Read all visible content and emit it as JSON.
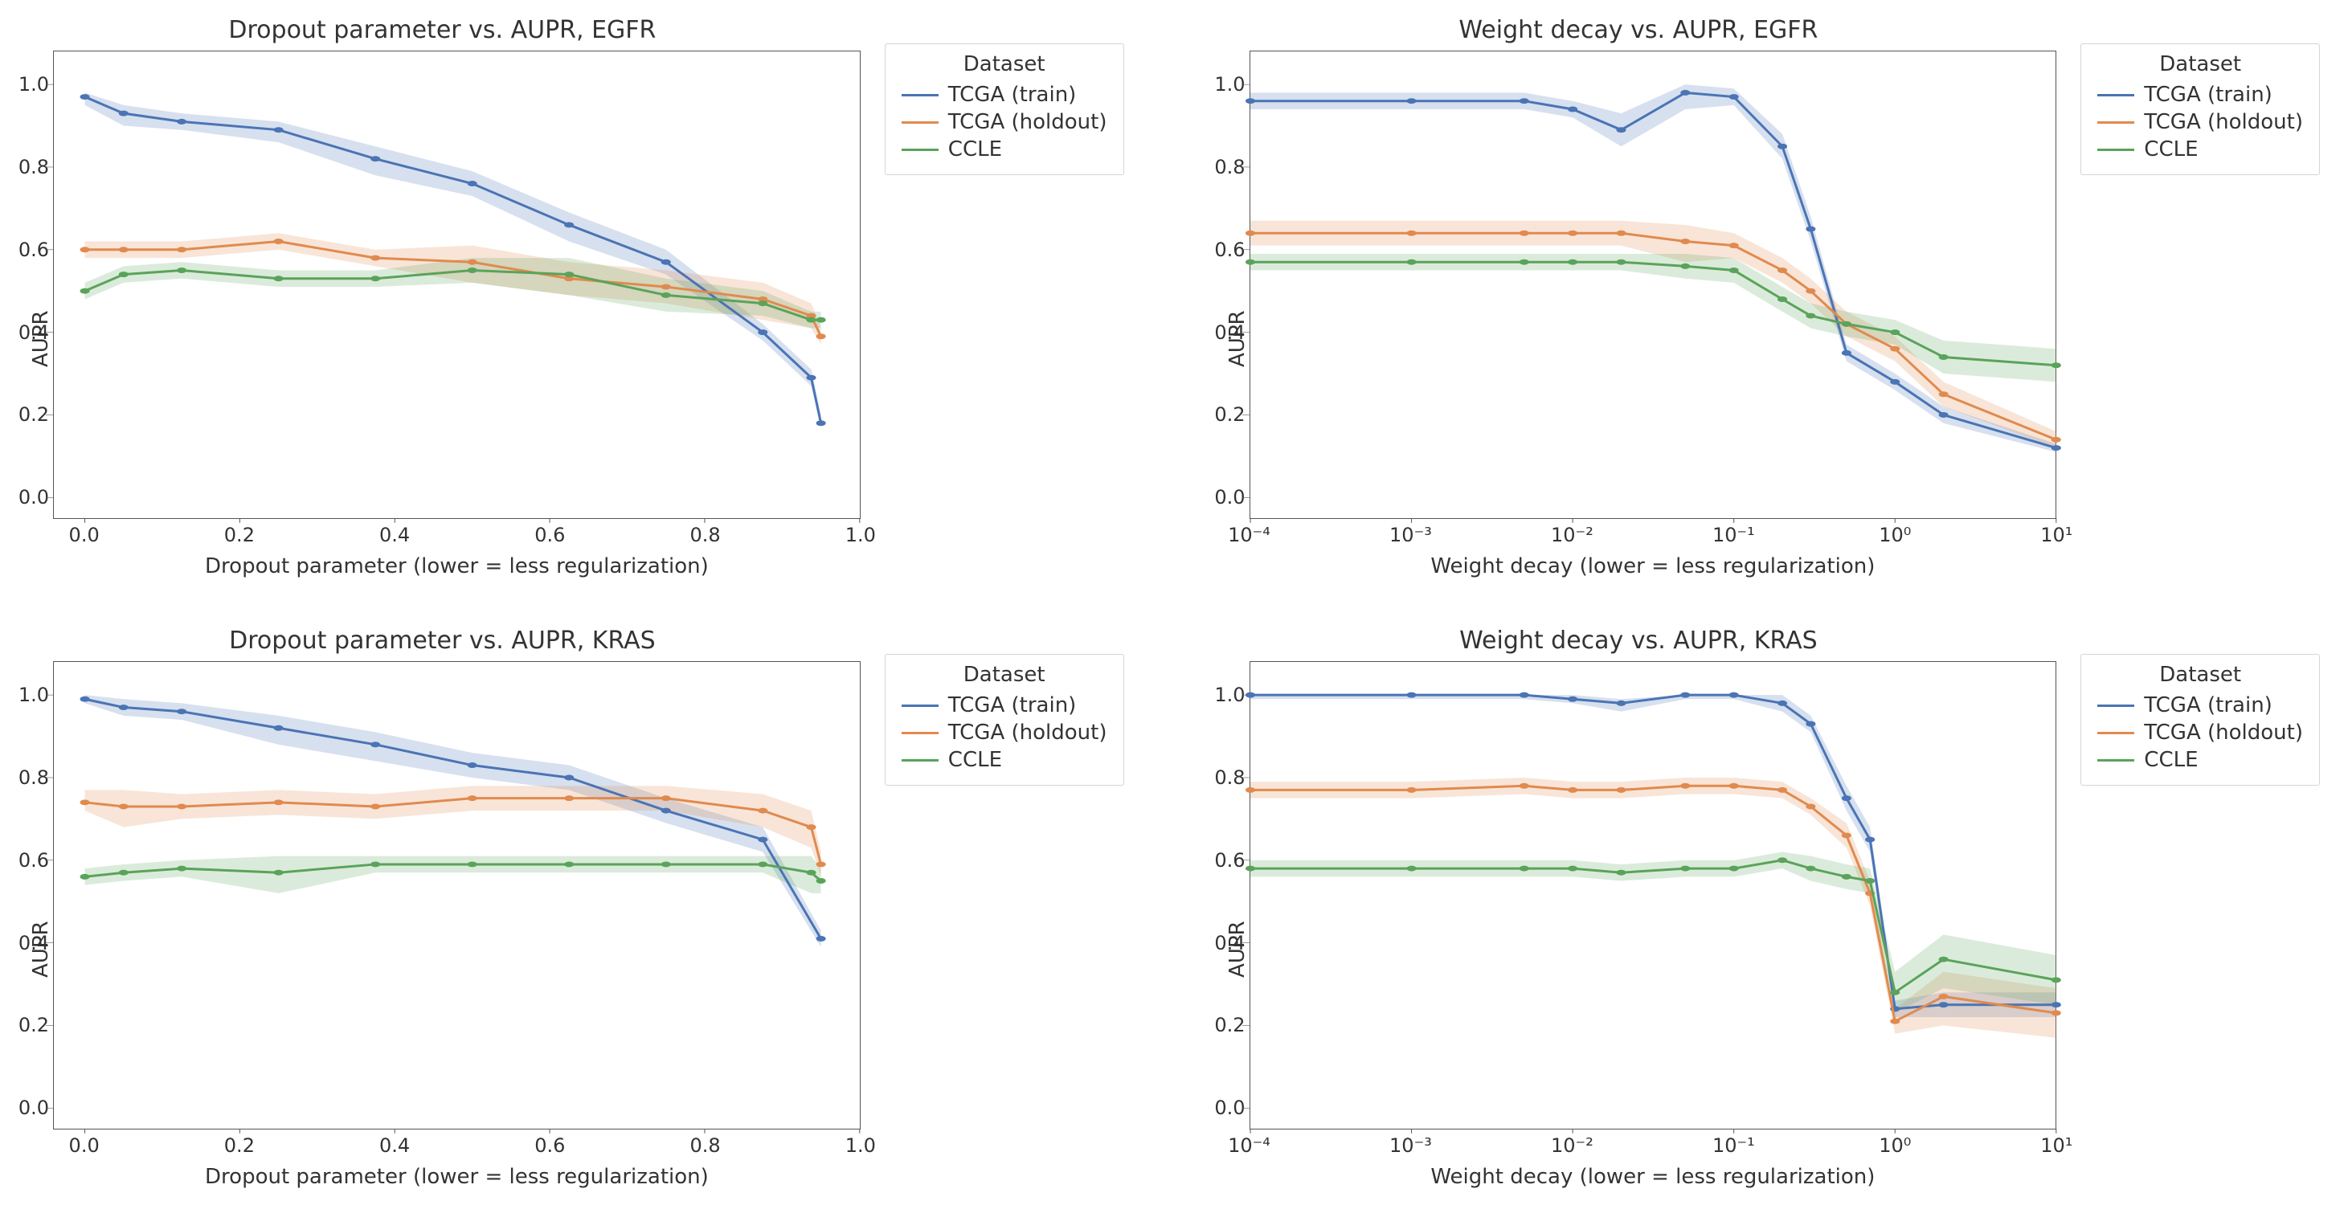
{
  "legend": {
    "title": "Dataset",
    "items": [
      {
        "name": "TCGA (train)",
        "color": "#4a74b4"
      },
      {
        "name": "TCGA (holdout)",
        "color": "#e18a4e"
      },
      {
        "name": "CCLE",
        "color": "#5aa35a"
      }
    ]
  },
  "panels": [
    {
      "id": "dropout-egfr",
      "title": "Dropout parameter vs. AUPR, EGFR",
      "xlabel": "Dropout parameter (lower = less regularization)",
      "ylabel": "AUPR",
      "xscale": "linear",
      "xlim": [
        -0.04,
        1.0
      ],
      "xticks": [
        0.0,
        0.2,
        0.4,
        0.6,
        0.8,
        1.0
      ],
      "ylim": [
        -0.05,
        1.08
      ],
      "yticks": [
        0.0,
        0.2,
        0.4,
        0.6,
        0.8,
        1.0
      ]
    },
    {
      "id": "wd-egfr",
      "title": "Weight decay vs. AUPR, EGFR",
      "xlabel": "Weight decay (lower = less regularization)",
      "ylabel": "AUPR",
      "xscale": "log",
      "xlim": [
        0.0001,
        10
      ],
      "xticks": [
        0.0001,
        0.001,
        0.01,
        0.1,
        1,
        10
      ],
      "xticklabels": [
        "10⁻⁴",
        "10⁻³",
        "10⁻²",
        "10⁻¹",
        "10⁰",
        "10¹"
      ],
      "ylim": [
        -0.05,
        1.08
      ],
      "yticks": [
        0.0,
        0.2,
        0.4,
        0.6,
        0.8,
        1.0
      ]
    },
    {
      "id": "dropout-kras",
      "title": "Dropout parameter vs. AUPR, KRAS",
      "xlabel": "Dropout parameter (lower = less regularization)",
      "ylabel": "AUPR",
      "xscale": "linear",
      "xlim": [
        -0.04,
        1.0
      ],
      "xticks": [
        0.0,
        0.2,
        0.4,
        0.6,
        0.8,
        1.0
      ],
      "ylim": [
        -0.05,
        1.08
      ],
      "yticks": [
        0.0,
        0.2,
        0.4,
        0.6,
        0.8,
        1.0
      ]
    },
    {
      "id": "wd-kras",
      "title": "Weight decay vs. AUPR, KRAS",
      "xlabel": "Weight decay (lower = less regularization)",
      "ylabel": "AUPR",
      "xscale": "log",
      "xlim": [
        0.0001,
        10
      ],
      "xticks": [
        0.0001,
        0.001,
        0.01,
        0.1,
        1,
        10
      ],
      "xticklabels": [
        "10⁻⁴",
        "10⁻³",
        "10⁻²",
        "10⁻¹",
        "10⁰",
        "10¹"
      ],
      "ylim": [
        -0.05,
        1.08
      ],
      "yticks": [
        0.0,
        0.2,
        0.4,
        0.6,
        0.8,
        1.0
      ]
    }
  ],
  "chart_data": [
    {
      "id": "dropout-egfr",
      "type": "line",
      "x": [
        0.0,
        0.05,
        0.125,
        0.25,
        0.375,
        0.5,
        0.625,
        0.75,
        0.875,
        0.95
      ],
      "series": [
        {
          "name": "TCGA (train)",
          "color": "#4a74b4",
          "y": [
            0.97,
            0.93,
            0.91,
            0.89,
            0.82,
            0.76,
            0.66,
            0.57,
            0.4,
            0.29,
            0.18
          ],
          "lo": [
            0.95,
            0.9,
            0.89,
            0.86,
            0.78,
            0.73,
            0.62,
            0.54,
            0.38,
            0.27,
            0.17
          ],
          "hi": [
            0.98,
            0.95,
            0.93,
            0.91,
            0.85,
            0.79,
            0.69,
            0.6,
            0.42,
            0.31,
            0.2
          ],
          "x": [
            0.0,
            0.05,
            0.125,
            0.25,
            0.375,
            0.5,
            0.625,
            0.75,
            0.875,
            0.9375,
            0.95
          ]
        },
        {
          "name": "TCGA (holdout)",
          "color": "#e18a4e",
          "y": [
            0.6,
            0.6,
            0.6,
            0.62,
            0.58,
            0.57,
            0.53,
            0.51,
            0.48,
            0.44,
            0.39
          ],
          "lo": [
            0.58,
            0.58,
            0.58,
            0.6,
            0.56,
            0.52,
            0.49,
            0.47,
            0.43,
            0.41,
            0.37
          ],
          "hi": [
            0.62,
            0.62,
            0.62,
            0.64,
            0.6,
            0.61,
            0.57,
            0.55,
            0.52,
            0.47,
            0.41
          ],
          "x": [
            0.0,
            0.05,
            0.125,
            0.25,
            0.375,
            0.5,
            0.625,
            0.75,
            0.875,
            0.9375,
            0.95
          ]
        },
        {
          "name": "CCLE",
          "color": "#5aa35a",
          "y": [
            0.5,
            0.54,
            0.55,
            0.53,
            0.53,
            0.55,
            0.54,
            0.49,
            0.47,
            0.43,
            0.43
          ],
          "lo": [
            0.48,
            0.52,
            0.53,
            0.51,
            0.51,
            0.52,
            0.49,
            0.45,
            0.44,
            0.41,
            0.41
          ],
          "hi": [
            0.52,
            0.56,
            0.57,
            0.55,
            0.55,
            0.58,
            0.58,
            0.53,
            0.5,
            0.45,
            0.45
          ],
          "x": [
            0.0,
            0.05,
            0.125,
            0.25,
            0.375,
            0.5,
            0.625,
            0.75,
            0.875,
            0.9375,
            0.95
          ]
        }
      ]
    },
    {
      "id": "wd-egfr",
      "type": "line",
      "x": [
        0.0001,
        0.001,
        0.005,
        0.01,
        0.02,
        0.05,
        0.1,
        0.2,
        0.3,
        0.5,
        1,
        2,
        10
      ],
      "series": [
        {
          "name": "TCGA (train)",
          "color": "#4a74b4",
          "y": [
            0.96,
            0.96,
            0.96,
            0.94,
            0.89,
            0.98,
            0.97,
            0.85,
            0.65,
            0.35,
            0.28,
            0.2,
            0.12
          ],
          "lo": [
            0.94,
            0.94,
            0.94,
            0.92,
            0.85,
            0.94,
            0.95,
            0.82,
            0.62,
            0.33,
            0.26,
            0.18,
            0.11
          ],
          "hi": [
            0.98,
            0.98,
            0.98,
            0.96,
            0.93,
            1.0,
            0.99,
            0.88,
            0.68,
            0.37,
            0.3,
            0.22,
            0.13
          ]
        },
        {
          "name": "TCGA (holdout)",
          "color": "#e18a4e",
          "y": [
            0.64,
            0.64,
            0.64,
            0.64,
            0.64,
            0.62,
            0.61,
            0.55,
            0.5,
            0.42,
            0.36,
            0.25,
            0.14
          ],
          "lo": [
            0.61,
            0.61,
            0.61,
            0.61,
            0.61,
            0.57,
            0.58,
            0.52,
            0.47,
            0.39,
            0.33,
            0.22,
            0.12
          ],
          "hi": [
            0.67,
            0.67,
            0.67,
            0.67,
            0.67,
            0.66,
            0.64,
            0.58,
            0.53,
            0.45,
            0.39,
            0.28,
            0.16
          ]
        },
        {
          "name": "CCLE",
          "color": "#5aa35a",
          "y": [
            0.57,
            0.57,
            0.57,
            0.57,
            0.57,
            0.56,
            0.55,
            0.48,
            0.44,
            0.42,
            0.4,
            0.34,
            0.32
          ],
          "lo": [
            0.55,
            0.55,
            0.55,
            0.55,
            0.55,
            0.53,
            0.52,
            0.45,
            0.41,
            0.39,
            0.37,
            0.3,
            0.28
          ],
          "hi": [
            0.59,
            0.59,
            0.59,
            0.59,
            0.59,
            0.59,
            0.58,
            0.51,
            0.47,
            0.45,
            0.43,
            0.38,
            0.36
          ]
        }
      ]
    },
    {
      "id": "dropout-kras",
      "type": "line",
      "x": [
        0.0,
        0.05,
        0.125,
        0.25,
        0.375,
        0.5,
        0.625,
        0.75,
        0.875,
        0.95
      ],
      "series": [
        {
          "name": "TCGA (train)",
          "color": "#4a74b4",
          "y": [
            0.99,
            0.97,
            0.96,
            0.92,
            0.88,
            0.83,
            0.8,
            0.72,
            0.65,
            0.41
          ],
          "lo": [
            0.98,
            0.95,
            0.94,
            0.88,
            0.84,
            0.8,
            0.77,
            0.69,
            0.62,
            0.39
          ],
          "hi": [
            1.0,
            0.99,
            0.98,
            0.95,
            0.91,
            0.86,
            0.83,
            0.75,
            0.68,
            0.43
          ]
        },
        {
          "name": "TCGA (holdout)",
          "color": "#e18a4e",
          "y": [
            0.74,
            0.73,
            0.73,
            0.74,
            0.73,
            0.75,
            0.75,
            0.75,
            0.72,
            0.68,
            0.59
          ],
          "lo": [
            0.72,
            0.68,
            0.7,
            0.71,
            0.7,
            0.72,
            0.72,
            0.72,
            0.68,
            0.63,
            0.56
          ],
          "hi": [
            0.77,
            0.77,
            0.76,
            0.77,
            0.76,
            0.78,
            0.78,
            0.78,
            0.76,
            0.72,
            0.62
          ],
          "x": [
            0.0,
            0.05,
            0.125,
            0.25,
            0.375,
            0.5,
            0.625,
            0.75,
            0.875,
            0.9375,
            0.95
          ]
        },
        {
          "name": "CCLE",
          "color": "#5aa35a",
          "y": [
            0.56,
            0.57,
            0.58,
            0.57,
            0.59,
            0.59,
            0.59,
            0.59,
            0.59,
            0.57,
            0.55
          ],
          "lo": [
            0.54,
            0.55,
            0.56,
            0.52,
            0.57,
            0.57,
            0.57,
            0.57,
            0.57,
            0.52,
            0.52
          ],
          "hi": [
            0.58,
            0.59,
            0.6,
            0.61,
            0.61,
            0.61,
            0.61,
            0.61,
            0.61,
            0.61,
            0.58
          ],
          "x": [
            0.0,
            0.05,
            0.125,
            0.25,
            0.375,
            0.5,
            0.625,
            0.75,
            0.875,
            0.9375,
            0.95
          ]
        }
      ]
    },
    {
      "id": "wd-kras",
      "type": "line",
      "x": [
        0.0001,
        0.001,
        0.005,
        0.01,
        0.02,
        0.05,
        0.1,
        0.2,
        0.3,
        0.5,
        0.7,
        1,
        2,
        10
      ],
      "series": [
        {
          "name": "TCGA (train)",
          "color": "#4a74b4",
          "y": [
            1.0,
            1.0,
            1.0,
            0.99,
            0.98,
            1.0,
            1.0,
            0.98,
            0.93,
            0.75,
            0.65,
            0.24,
            0.25,
            0.25
          ],
          "lo": [
            0.99,
            0.99,
            0.99,
            0.98,
            0.96,
            0.99,
            0.99,
            0.96,
            0.91,
            0.72,
            0.62,
            0.22,
            0.22,
            0.22
          ],
          "hi": [
            1.0,
            1.0,
            1.0,
            1.0,
            0.99,
            1.0,
            1.0,
            1.0,
            0.95,
            0.78,
            0.68,
            0.26,
            0.28,
            0.28
          ]
        },
        {
          "name": "TCGA (holdout)",
          "color": "#e18a4e",
          "y": [
            0.77,
            0.77,
            0.78,
            0.77,
            0.77,
            0.78,
            0.78,
            0.77,
            0.73,
            0.66,
            0.52,
            0.21,
            0.27,
            0.23
          ],
          "lo": [
            0.75,
            0.75,
            0.76,
            0.75,
            0.75,
            0.76,
            0.76,
            0.75,
            0.71,
            0.63,
            0.49,
            0.18,
            0.2,
            0.17
          ],
          "hi": [
            0.79,
            0.79,
            0.8,
            0.79,
            0.79,
            0.8,
            0.8,
            0.79,
            0.75,
            0.69,
            0.55,
            0.24,
            0.33,
            0.29
          ]
        },
        {
          "name": "CCLE",
          "color": "#5aa35a",
          "y": [
            0.58,
            0.58,
            0.58,
            0.58,
            0.57,
            0.58,
            0.58,
            0.6,
            0.58,
            0.56,
            0.55,
            0.28,
            0.36,
            0.31
          ],
          "lo": [
            0.56,
            0.56,
            0.56,
            0.56,
            0.55,
            0.56,
            0.56,
            0.58,
            0.55,
            0.53,
            0.52,
            0.23,
            0.29,
            0.25
          ],
          "hi": [
            0.6,
            0.6,
            0.6,
            0.6,
            0.59,
            0.6,
            0.6,
            0.62,
            0.61,
            0.59,
            0.58,
            0.33,
            0.42,
            0.37
          ]
        }
      ]
    }
  ]
}
